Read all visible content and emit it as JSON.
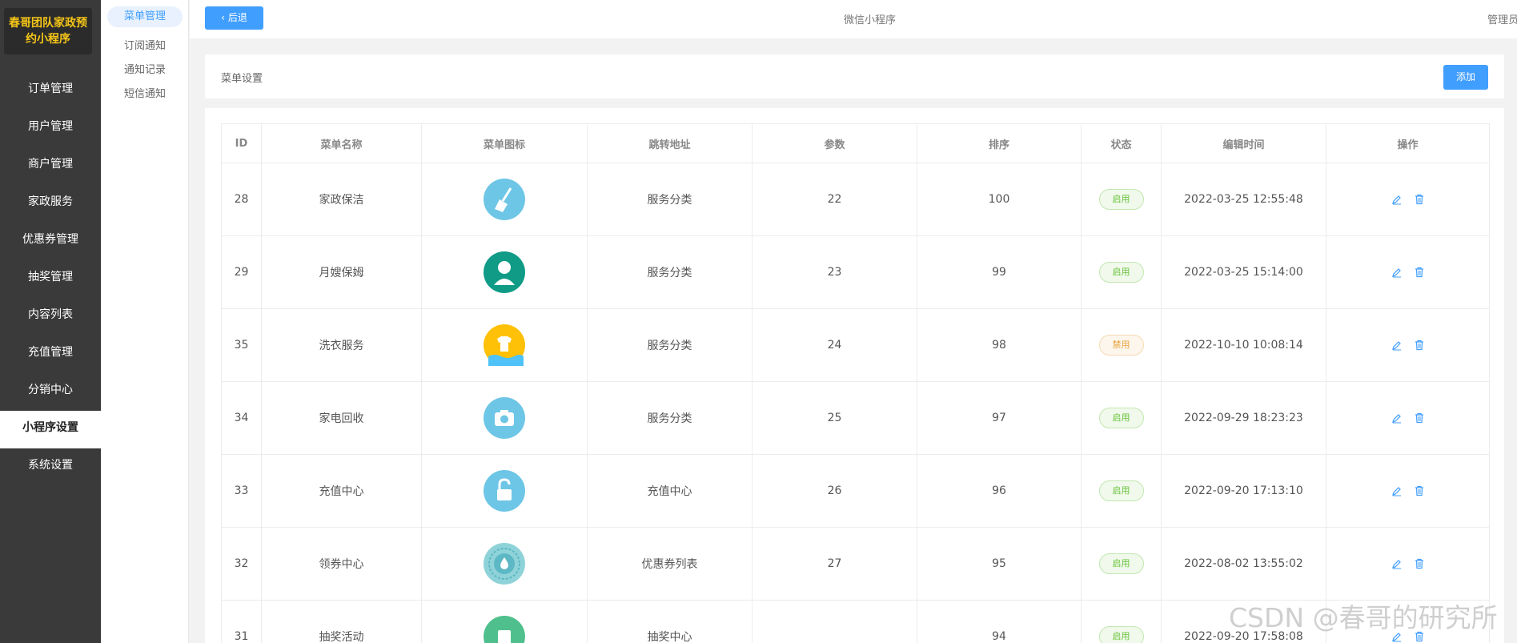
{
  "app": {
    "logo_text": "春哥团队家政预约小程序"
  },
  "sidebar": {
    "items": [
      {
        "label": "订单管理"
      },
      {
        "label": "用户管理"
      },
      {
        "label": "商户管理"
      },
      {
        "label": "家政服务"
      },
      {
        "label": "优惠券管理"
      },
      {
        "label": "抽奖管理"
      },
      {
        "label": "内容列表"
      },
      {
        "label": "充值管理"
      },
      {
        "label": "分销中心"
      },
      {
        "label": "小程序设置"
      },
      {
        "label": "系统设置"
      }
    ],
    "active_index": 9
  },
  "submenu": {
    "items": [
      {
        "label": "菜单管理"
      },
      {
        "label": "订阅通知"
      },
      {
        "label": "通知记录"
      },
      {
        "label": "短信通知"
      }
    ],
    "active_index": 0
  },
  "topbar": {
    "back_label": "后退",
    "title": "微信小程序",
    "user": "管理员"
  },
  "page": {
    "title": "菜单设置",
    "add_label": "添加"
  },
  "table": {
    "columns": [
      "ID",
      "菜单名称",
      "菜单图标",
      "跳转地址",
      "参数",
      "排序",
      "状态",
      "编辑时间",
      "操作"
    ],
    "rows": [
      {
        "id": "28",
        "name": "家政保洁",
        "icon": "broom-icon",
        "icon_color": "#6ec6e6",
        "link": "服务分类",
        "param": "22",
        "sort": "100",
        "status": "启用",
        "status_type": "on",
        "time": "2022-03-25 12:55:48"
      },
      {
        "id": "29",
        "name": "月嫂保姆",
        "icon": "nanny-icon",
        "icon_color": "#0f9b86",
        "link": "服务分类",
        "param": "23",
        "sort": "99",
        "status": "启用",
        "status_type": "on",
        "time": "2022-03-25 15:14:00"
      },
      {
        "id": "35",
        "name": "洗衣服务",
        "icon": "laundry-icon",
        "icon_color": "#ffc107",
        "link": "服务分类",
        "param": "24",
        "sort": "98",
        "status": "禁用",
        "status_type": "off",
        "time": "2022-10-10 10:08:14"
      },
      {
        "id": "34",
        "name": "家电回收",
        "icon": "camera-icon",
        "icon_color": "#6ec6e6",
        "link": "服务分类",
        "param": "25",
        "sort": "97",
        "status": "启用",
        "status_type": "on",
        "time": "2022-09-29 18:23:23"
      },
      {
        "id": "33",
        "name": "充值中心",
        "icon": "unlock-icon",
        "icon_color": "#6ec6e6",
        "link": "充值中心",
        "param": "26",
        "sort": "96",
        "status": "启用",
        "status_type": "on",
        "time": "2022-09-20 17:13:10"
      },
      {
        "id": "32",
        "name": "领券中心",
        "icon": "coupon-drop-icon",
        "icon_color": "#8fd3d9",
        "link": "优惠券列表",
        "param": "27",
        "sort": "95",
        "status": "启用",
        "status_type": "on",
        "time": "2022-08-02 13:55:02"
      },
      {
        "id": "31",
        "name": "抽奖活动",
        "icon": "lottery-icon",
        "icon_color": "#4fc08d",
        "link": "抽奖中心",
        "param": "",
        "sort": "94",
        "status": "启用",
        "status_type": "on",
        "time": "2022-09-20 17:58:08"
      }
    ]
  },
  "colors": {
    "primary": "#409eff",
    "sidebar_bg": "#3a3a3a",
    "logo_text": "#f5c518",
    "enabled": "#67c23a",
    "disabled": "#e6a23c"
  },
  "watermark": "CSDN @春哥的研究所"
}
